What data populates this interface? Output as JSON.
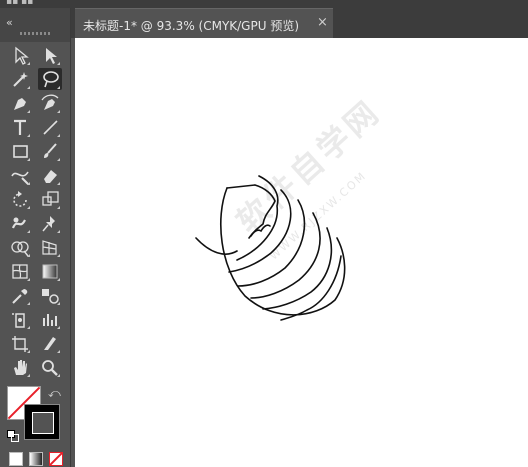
{
  "document": {
    "tab_title": "未标题-1* @ 93.3% (CMYK/GPU 预览)",
    "close_glyph": "×"
  },
  "toolbar": {
    "collapse_glyph": "«",
    "swap_glyph": "⤺",
    "tools": [
      {
        "name": "selection-tool",
        "icon": "arrow-outline-icon"
      },
      {
        "name": "direct-selection-tool",
        "icon": "arrow-filled-icon"
      },
      {
        "name": "magic-wand-tool",
        "icon": "magic-wand-icon"
      },
      {
        "name": "lasso-tool",
        "icon": "lasso-icon",
        "active": true
      },
      {
        "name": "pen-tool",
        "icon": "pen-icon"
      },
      {
        "name": "curvature-tool",
        "icon": "curvature-pen-icon"
      },
      {
        "name": "type-tool",
        "icon": "type-icon"
      },
      {
        "name": "line-segment-tool",
        "icon": "line-icon"
      },
      {
        "name": "rectangle-tool",
        "icon": "rectangle-icon"
      },
      {
        "name": "paintbrush-tool",
        "icon": "brush-icon"
      },
      {
        "name": "shaper-tool",
        "icon": "shaper-icon"
      },
      {
        "name": "eraser-tool",
        "icon": "eraser-icon"
      },
      {
        "name": "rotate-tool",
        "icon": "rotate-icon"
      },
      {
        "name": "scale-tool",
        "icon": "scale-icon"
      },
      {
        "name": "warp-tool",
        "icon": "warp-icon"
      },
      {
        "name": "puppet-warp-tool",
        "icon": "pin-icon"
      },
      {
        "name": "shape-builder-tool",
        "icon": "shape-builder-icon"
      },
      {
        "name": "perspective-grid-tool",
        "icon": "perspective-icon"
      },
      {
        "name": "mesh-tool",
        "icon": "mesh-icon"
      },
      {
        "name": "gradient-tool",
        "icon": "gradient-icon"
      },
      {
        "name": "eyedropper-tool",
        "icon": "eyedropper-icon"
      },
      {
        "name": "blend-tool",
        "icon": "blend-icon"
      },
      {
        "name": "symbol-sprayer-tool",
        "icon": "symbol-sprayer-icon"
      },
      {
        "name": "column-graph-tool",
        "icon": "bar-graph-icon"
      },
      {
        "name": "artboard-tool",
        "icon": "artboard-icon"
      },
      {
        "name": "slice-tool",
        "icon": "knife-icon"
      },
      {
        "name": "hand-tool",
        "icon": "hand-icon"
      },
      {
        "name": "zoom-tool",
        "icon": "zoom-icon"
      }
    ],
    "fill_color": "#ffffff",
    "stroke_color": "#000000"
  },
  "canvas": {
    "watermark": "软件自学网",
    "watermark_url": "WWW.RJZXW.COM"
  }
}
